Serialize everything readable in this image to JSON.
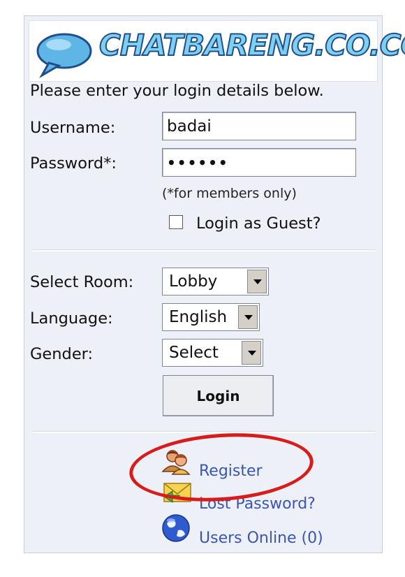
{
  "banner": {
    "logo_text": "CHATBARENG.CO.CC"
  },
  "intro_text": "Please enter your login details below.",
  "form": {
    "username_label": "Username:",
    "username_value": "badai",
    "password_label": "Password*:",
    "password_value": "••••••",
    "members_note": "(*for members only)",
    "guest_label": "Login as Guest?",
    "guest_checked": false,
    "room_label": "Select Room:",
    "room_value": "Lobby",
    "language_label": "Language:",
    "language_value": "English",
    "gender_label": "Gender:",
    "gender_value": "Select",
    "login_button": "Login"
  },
  "links": {
    "register": "Register",
    "lost_password": "Lost Password?",
    "users_online": "Users Online (0)"
  },
  "colors": {
    "panel_bg": "#eef0f8",
    "link": "#3a55b4",
    "highlight_oval": "#d81c1c",
    "logo_fill": "#7fd0f0"
  },
  "icons": {
    "logo": "speech-bubble-icon",
    "register": "users-icon",
    "lost_password": "envelope-icon",
    "users_online": "globe-icon"
  }
}
